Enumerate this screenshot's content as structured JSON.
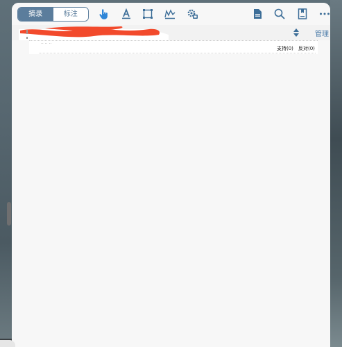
{
  "toolbar": {
    "segments": [
      {
        "label": "摘录",
        "active": true
      },
      {
        "label": "标注",
        "active": false
      }
    ],
    "accent_color": "#5b7d9c",
    "tools": [
      "hand-pointer-icon",
      "text-underline-icon",
      "rectangle-select-icon",
      "signature-icon",
      "gear-stamp-icon"
    ],
    "right_tools": [
      "document-icon",
      "search-icon",
      "bookmark-icon",
      "more-icon"
    ]
  },
  "tabbar": {
    "tab_label_redacted": true,
    "manage_label": "管理",
    "manage_color": "#4a7aa8"
  },
  "document": {
    "support_label": "支持(0)",
    "oppose_label": "反对(0)",
    "dots": "·· ·· ··"
  }
}
